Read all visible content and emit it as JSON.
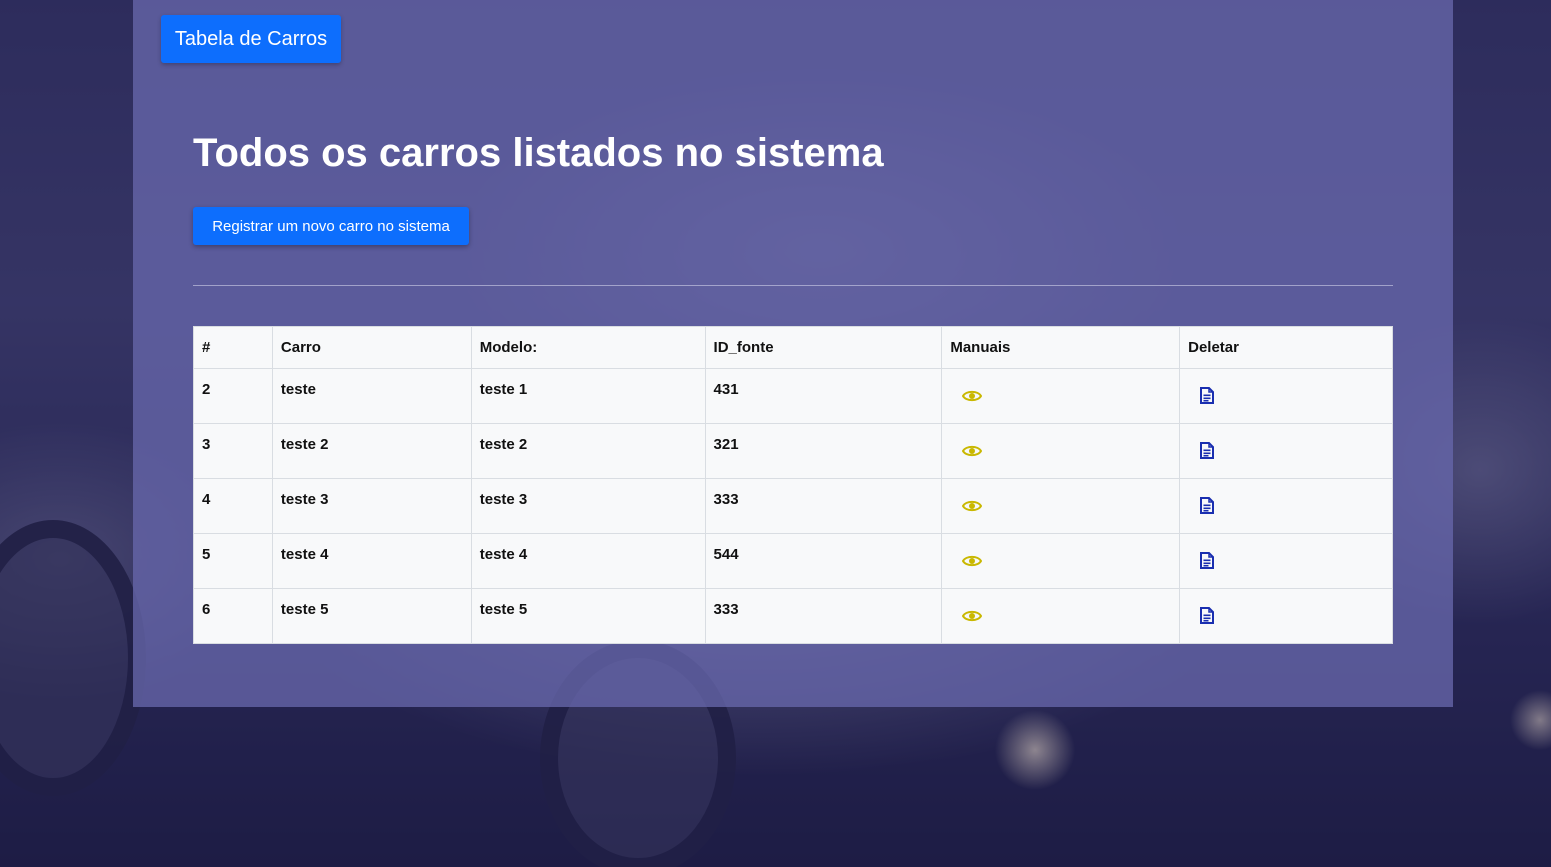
{
  "navbar": {
    "brand_label": "Tabela de Carros"
  },
  "main": {
    "title": "Todos os carros listados no sistema",
    "register_button_label": "Registrar um novo carro no sistema"
  },
  "table": {
    "headers": [
      "#",
      "Carro",
      "Modelo:",
      "ID_fonte",
      "Manuais",
      "Deletar"
    ],
    "rows": [
      {
        "id": "2",
        "carro": "teste",
        "modelo": "teste 1",
        "id_fonte": "431"
      },
      {
        "id": "3",
        "carro": "teste 2",
        "modelo": "teste 2",
        "id_fonte": "321"
      },
      {
        "id": "4",
        "carro": "teste 3",
        "modelo": "teste 3",
        "id_fonte": "333"
      },
      {
        "id": "5",
        "carro": "teste 4",
        "modelo": "teste 4",
        "id_fonte": "544"
      },
      {
        "id": "6",
        "carro": "teste 5",
        "modelo": "teste 5",
        "id_fonte": "333"
      }
    ],
    "manuais_icon": "eye-icon",
    "deletar_icon": "document-icon"
  },
  "colors": {
    "primary": "#0d6efd",
    "panel": "#6666aa",
    "eye_icon": "#c9b800",
    "doc_icon": "#1a2fb0"
  }
}
